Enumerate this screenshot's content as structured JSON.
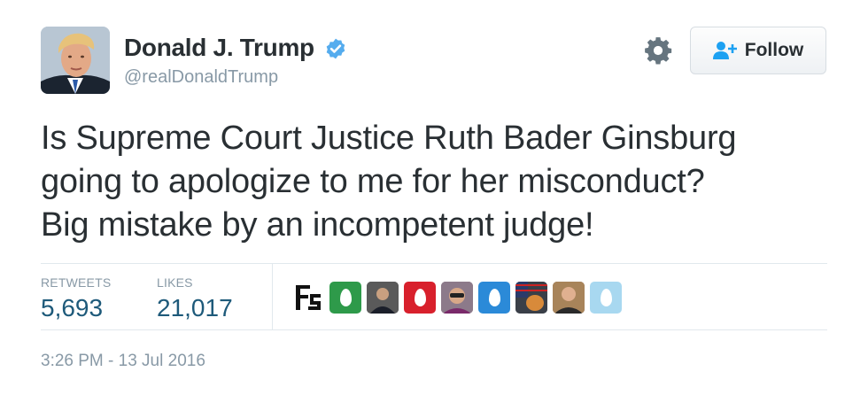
{
  "user": {
    "name": "Donald J. Trump",
    "handle": "@realDonaldTrump",
    "verified": true
  },
  "follow_button": {
    "label": "Follow",
    "icon": "person-plus-icon"
  },
  "settings_icon": "gear-icon",
  "tweet": {
    "lines": [
      "Is Supreme Court Justice Ruth Bader Ginsburg",
      "going to apologize to me for her misconduct?",
      "Big mistake by an incompetent judge!"
    ]
  },
  "stats": {
    "retweets_label": "RETWEETS",
    "retweets_value": "5,693",
    "likes_label": "LIKES",
    "likes_value": "21,017"
  },
  "likers": [
    {
      "kind": "logo",
      "color": "#ffffff"
    },
    {
      "kind": "egg",
      "color": "#2e9a4a"
    },
    {
      "kind": "photo",
      "color": "#4a4a4a"
    },
    {
      "kind": "egg",
      "color": "#d8202c"
    },
    {
      "kind": "photo",
      "color": "#7a5a6a"
    },
    {
      "kind": "egg",
      "color": "#2b8ad8"
    },
    {
      "kind": "photo",
      "color": "#5a6470"
    },
    {
      "kind": "photo",
      "color": "#8a5a3a"
    },
    {
      "kind": "egg",
      "color": "#a8d8f0"
    }
  ],
  "timestamp": "3:26 PM - 13 Jul 2016",
  "colors": {
    "text": "#292f33",
    "muted": "#8899a6",
    "stat_value": "#1e5a7a",
    "verified": "#55acee",
    "follow_icon": "#1da1f2"
  }
}
